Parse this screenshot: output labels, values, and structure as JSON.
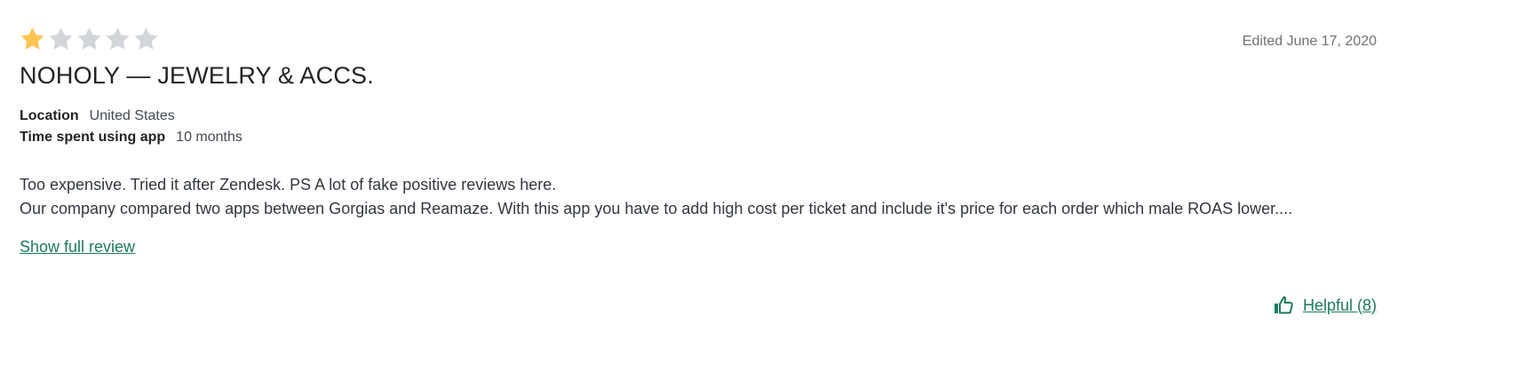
{
  "review": {
    "rating": 1,
    "rating_max": 5,
    "edited_date": "Edited June 17, 2020",
    "shop_name": "NOHOLY — JEWELRY & ACCS.",
    "location_label": "Location",
    "location_value": "United States",
    "time_label": "Time spent using app",
    "time_value": "10 months",
    "body_line_1": "Too expensive. Tried it after Zendesk. PS A lot of fake positive reviews here.",
    "body_line_2": "Our company compared two apps between Gorgias and Reamaze. With this app you have to add high cost per ticket and include it's price for each order which male ROAS lower....",
    "show_full_label": "Show full review",
    "helpful_label": "Helpful (8)"
  },
  "colors": {
    "star_filled": "#FFC453",
    "star_empty": "#D2D5D9",
    "link_green": "#1C7A5A",
    "muted_text": "#6D7175"
  },
  "icons": {
    "star": "star-icon",
    "thumbs_up": "thumbs-up-icon"
  }
}
